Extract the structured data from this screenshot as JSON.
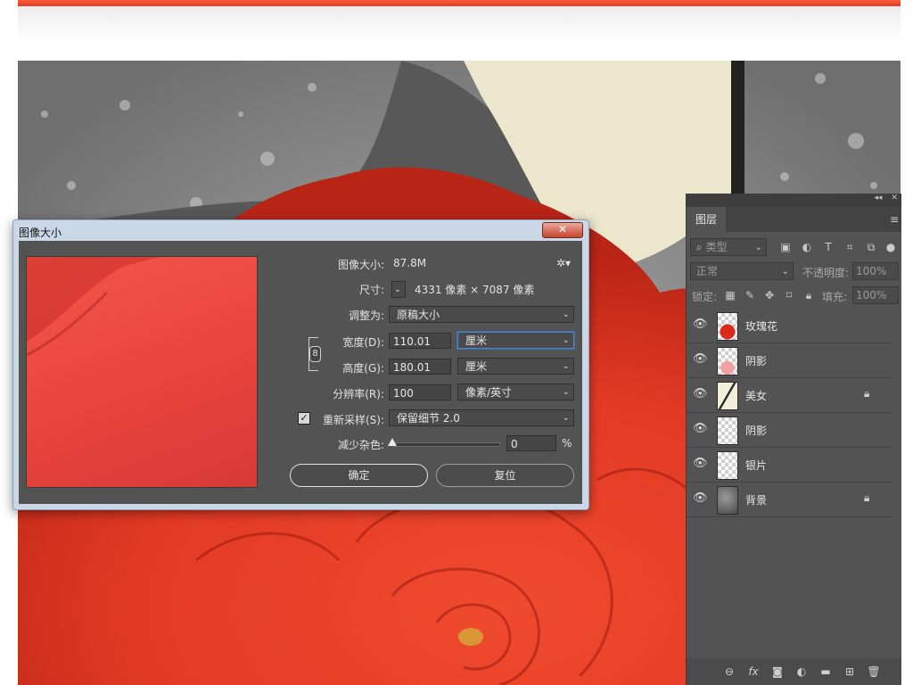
{
  "dialog": {
    "title": "图像大小",
    "close_glyph": "✕",
    "image_size_label": "图像大小:",
    "image_size_value": "87.8M",
    "settings_glyph": "✲▾",
    "dimensions_label": "尺寸:",
    "dimensions_value": "4331 像素  ×  7087 像素",
    "fit_to_label": "调整为:",
    "fit_to_value": "原稿大小",
    "width_label": "宽度(D):",
    "width_value": "110.01",
    "width_unit": "厘米",
    "height_label": "高度(G):",
    "height_value": "180.01",
    "height_unit": "厘米",
    "resolution_label": "分辨率(R):",
    "resolution_value": "100",
    "resolution_unit": "像素/英寸",
    "resample_label": "重新采样(S):",
    "resample_checked": true,
    "resample_value": "保留细节 2.0",
    "noise_label": "减少杂色:",
    "noise_value": "0",
    "noise_unit": "%",
    "noise_level": 0,
    "ok_label": "确定",
    "reset_label": "复位"
  },
  "layers_panel": {
    "collapse_glyph": "◂◂",
    "close_glyph": "✕",
    "tab_label": "图层",
    "menu_glyph": "≡",
    "filter_placeholder": "类型",
    "blend_mode": "正常",
    "opacity_label": "不透明度:",
    "opacity_value": "100%",
    "lock_label": "锁定:",
    "fill_label": "填充:",
    "fill_value": "100%",
    "layers": [
      {
        "name": "玫瑰花",
        "visible": true,
        "locked": false
      },
      {
        "name": "阴影",
        "visible": true,
        "locked": false
      },
      {
        "name": "美女",
        "visible": true,
        "locked": true
      },
      {
        "name": "阴影",
        "visible": true,
        "locked": false
      },
      {
        "name": "银片",
        "visible": true,
        "locked": false
      },
      {
        "name": "背景",
        "visible": true,
        "locked": true
      }
    ],
    "footer_icons": [
      "link-icon",
      "fx-icon",
      "mask-icon",
      "adjustment-icon",
      "folder-icon",
      "new-layer-icon",
      "trash-icon"
    ]
  },
  "colors": {
    "rose_red": "#e23a24",
    "panel_bg": "#535353",
    "dialog_frame": "#c9d7e6",
    "focus_blue": "#4f86c6"
  }
}
